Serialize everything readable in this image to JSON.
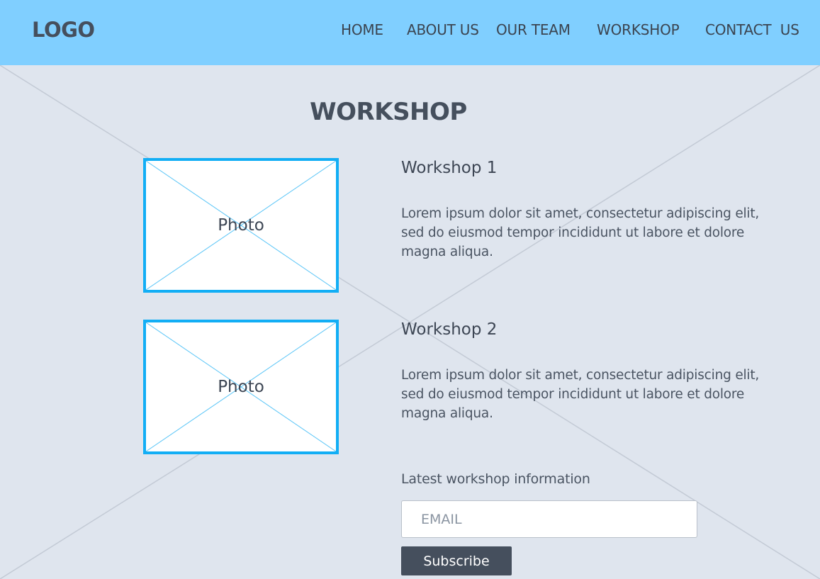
{
  "header": {
    "logo": "LOGO",
    "nav": {
      "home": "HOME",
      "about": "ABOUT US",
      "team": "OUR TEAM",
      "workshop": "WORKSHOP",
      "contact": "CONTACT  US"
    }
  },
  "main": {
    "title": "WORKSHOP",
    "workshops": [
      {
        "photo_label": "Photo",
        "title": "Workshop 1",
        "description": "Lorem ipsum dolor sit amet, consectetur adipiscing elit, sed do eiusmod tempor incididunt ut labore et dolore magna aliqua."
      },
      {
        "photo_label": "Photo",
        "title": "Workshop 2",
        "description": "Lorem ipsum dolor sit amet, consectetur adipiscing elit, sed do eiusmod tempor incididunt ut labore et dolore magna aliqua."
      }
    ],
    "newsletter": {
      "label": "Latest workshop information",
      "email_placeholder": "EMAIL",
      "button_label": "Subscribe"
    }
  },
  "colors": {
    "header_bg": "#80cfff",
    "page_bg": "#dfe5ee",
    "accent": "#12aef5",
    "text_dark": "#454f5d",
    "button_bg": "#454f5d"
  }
}
